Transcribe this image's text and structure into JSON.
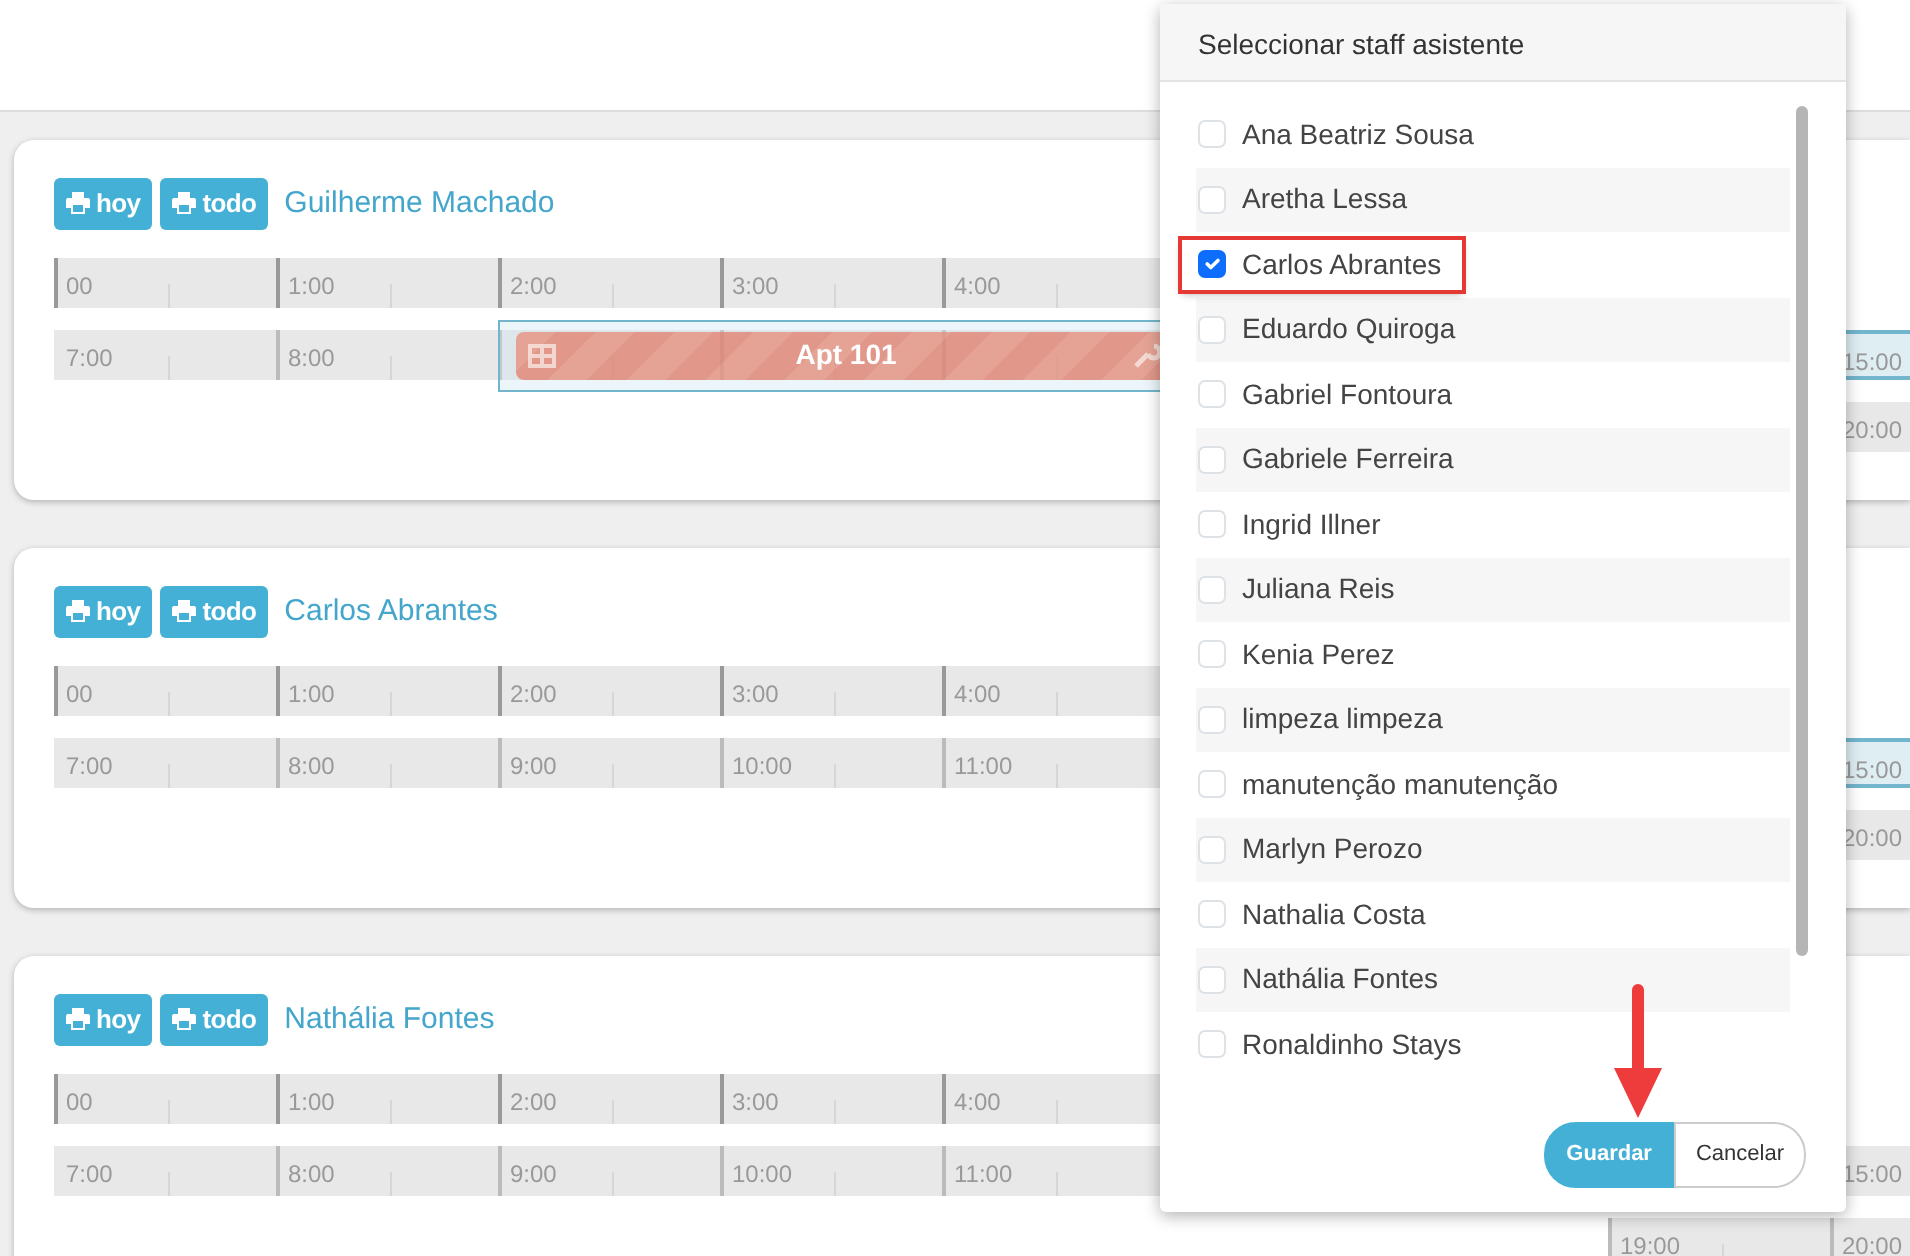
{
  "cards": [
    {
      "buttons": [
        {
          "label": "hoy"
        },
        {
          "label": "todo"
        }
      ],
      "name": "Guilherme Machado",
      "rows": [
        {
          "cells": [
            "00",
            "1:00",
            "2:00",
            "3:00",
            "4:00"
          ],
          "tail": [],
          "highlight": false
        },
        {
          "cells": [
            "7:00",
            "8:00"
          ],
          "tail": [
            "15:00"
          ],
          "highlight": true
        },
        {
          "cells": [],
          "tail": [
            "20:00"
          ],
          "highlight": false
        }
      ],
      "appointment": {
        "title": "Apt 101"
      }
    },
    {
      "buttons": [
        {
          "label": "hoy"
        },
        {
          "label": "todo"
        }
      ],
      "name": "Carlos Abrantes",
      "rows": [
        {
          "cells": [
            "00",
            "1:00",
            "2:00",
            "3:00",
            "4:00"
          ],
          "tail": [],
          "highlight": false
        },
        {
          "cells": [
            "7:00",
            "8:00",
            "9:00",
            "10:00",
            "11:00"
          ],
          "tail": [
            "15:00"
          ],
          "highlight": true
        },
        {
          "cells": [],
          "tail": [
            "20:00"
          ],
          "highlight": false
        }
      ]
    },
    {
      "buttons": [
        {
          "label": "hoy"
        },
        {
          "label": "todo"
        }
      ],
      "name": "Nathália Fontes",
      "rows": [
        {
          "cells": [
            "00",
            "1:00",
            "2:00",
            "3:00",
            "4:00"
          ],
          "tail": [],
          "highlight": false
        },
        {
          "cells": [
            "7:00",
            "8:00",
            "9:00",
            "10:00",
            "11:00"
          ],
          "tail": [
            "15:00"
          ],
          "highlight": false
        },
        {
          "cells": [],
          "tail": [
            "19:00",
            "20:00"
          ],
          "highlight": false
        }
      ]
    }
  ],
  "dialog": {
    "title": "Seleccionar staff asistente",
    "items": [
      {
        "label": "Ana Beatriz Sousa",
        "checked": false,
        "marked": false
      },
      {
        "label": "Aretha Lessa",
        "checked": false,
        "marked": false
      },
      {
        "label": "Carlos Abrantes",
        "checked": true,
        "marked": true
      },
      {
        "label": "Eduardo Quiroga",
        "checked": false,
        "marked": false
      },
      {
        "label": "Gabriel Fontoura",
        "checked": false,
        "marked": false
      },
      {
        "label": "Gabriele Ferreira",
        "checked": false,
        "marked": false
      },
      {
        "label": "Ingrid Illner",
        "checked": false,
        "marked": false
      },
      {
        "label": "Juliana Reis",
        "checked": false,
        "marked": false
      },
      {
        "label": "Kenia Perez",
        "checked": false,
        "marked": false
      },
      {
        "label": "limpeza limpeza",
        "checked": false,
        "marked": false
      },
      {
        "label": "manutenção manutenção",
        "checked": false,
        "marked": false
      },
      {
        "label": "Marlyn Perozo",
        "checked": false,
        "marked": false
      },
      {
        "label": "Nathalia Costa",
        "checked": false,
        "marked": false
      },
      {
        "label": "Nathália Fontes",
        "checked": false,
        "marked": false
      },
      {
        "label": "Ronaldinho Stays",
        "checked": false,
        "marked": false
      }
    ],
    "buttons": [
      {
        "label": "Guardar",
        "kind": "primary"
      },
      {
        "label": "Cancelar",
        "kind": "secondary"
      }
    ]
  }
}
